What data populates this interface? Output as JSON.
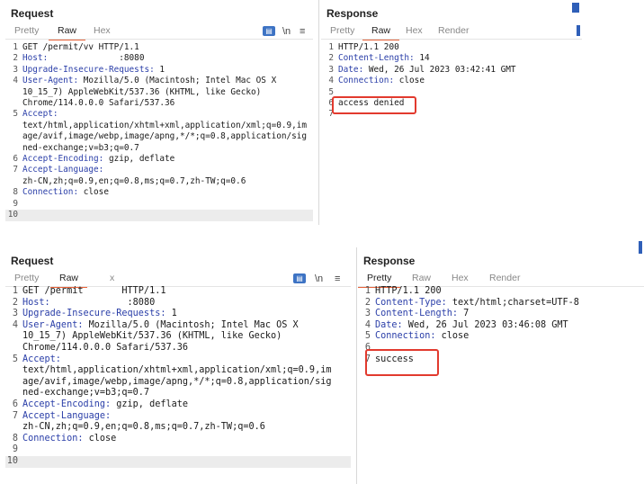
{
  "top": {
    "request": {
      "title": "Request",
      "tabs": [
        "Pretty",
        "Raw",
        "Hex"
      ],
      "active_tab": "Raw",
      "tools": {
        "toggle_icon": "\\n",
        "menu_icon": "≡"
      },
      "lines": [
        {
          "n": "1",
          "text": "GET /permit/vv HTTP/1.1"
        },
        {
          "n": "2",
          "key": "Host:",
          "text": "              :8080"
        },
        {
          "n": "3",
          "key": "Upgrade-Insecure-Requests:",
          "text": " 1"
        },
        {
          "n": "4",
          "key": "User-Agent:",
          "text": " Mozilla/5.0 (Macintosh; Intel Mac OS X"
        },
        {
          "n": "",
          "text": "10_15_7) AppleWebKit/537.36 (KHTML, like Gecko)"
        },
        {
          "n": "",
          "text": "Chrome/114.0.0.0 Safari/537.36"
        },
        {
          "n": "5",
          "key": "Accept:",
          "text": ""
        },
        {
          "n": "",
          "text": "text/html,application/xhtml+xml,application/xml;q=0.9,im"
        },
        {
          "n": "",
          "text": "age/avif,image/webp,image/apng,*/*;q=0.8,application/sig"
        },
        {
          "n": "",
          "text": "ned-exchange;v=b3;q=0.7"
        },
        {
          "n": "6",
          "key": "Accept-Encoding:",
          "text": " gzip, deflate"
        },
        {
          "n": "7",
          "key": "Accept-Language:",
          "text": ""
        },
        {
          "n": "",
          "text": "zh-CN,zh;q=0.9,en;q=0.8,ms;q=0.7,zh-TW;q=0.6"
        },
        {
          "n": "8",
          "key": "Connection:",
          "text": " close"
        },
        {
          "n": "9",
          "text": ""
        },
        {
          "n": "10",
          "text": "",
          "sel": true
        }
      ]
    },
    "response": {
      "title": "Response",
      "tabs": [
        "Pretty",
        "Raw",
        "Hex",
        "Render"
      ],
      "active_tab": "Raw",
      "lines": [
        {
          "n": "1",
          "text": "HTTP/1.1 200"
        },
        {
          "n": "2",
          "key": "Content-Length:",
          "text": " 14"
        },
        {
          "n": "3",
          "key": "Date:",
          "text": " Wed, 26 Jul 2023 03:42:41 GMT"
        },
        {
          "n": "4",
          "key": "Connection:",
          "text": " close"
        },
        {
          "n": "5",
          "text": ""
        },
        {
          "n": "6",
          "text": "access denied"
        },
        {
          "n": "7",
          "text": ""
        }
      ]
    }
  },
  "bottom": {
    "request": {
      "title": "Request",
      "tabs": [
        "Pretty",
        "Raw",
        "x"
      ],
      "active_tab": "Raw",
      "tools": {
        "toggle_icon": "\\n",
        "menu_icon": "≡"
      },
      "lines": [
        {
          "n": "1",
          "text": "GET /permit       HTTP/1.1"
        },
        {
          "n": "2",
          "key": "Host:",
          "text": "              :8080"
        },
        {
          "n": "3",
          "key": "Upgrade-Insecure-Requests:",
          "text": " 1"
        },
        {
          "n": "4",
          "key": "User-Agent:",
          "text": " Mozilla/5.0 (Macintosh; Intel Mac OS X"
        },
        {
          "n": "",
          "text": "10_15_7) AppleWebKit/537.36 (KHTML, like Gecko)"
        },
        {
          "n": "",
          "text": "Chrome/114.0.0.0 Safari/537.36"
        },
        {
          "n": "5",
          "key": "Accept:",
          "text": ""
        },
        {
          "n": "",
          "text": "text/html,application/xhtml+xml,application/xml;q=0.9,im"
        },
        {
          "n": "",
          "text": "age/avif,image/webp,image/apng,*/*;q=0.8,application/sig"
        },
        {
          "n": "",
          "text": "ned-exchange;v=b3;q=0.7"
        },
        {
          "n": "6",
          "key": "Accept-Encoding:",
          "text": " gzip, deflate"
        },
        {
          "n": "7",
          "key": "Accept-Language:",
          "text": ""
        },
        {
          "n": "",
          "text": "zh-CN,zh;q=0.9,en;q=0.8,ms;q=0.7,zh-TW;q=0.6"
        },
        {
          "n": "8",
          "key": "Connection:",
          "text": " close"
        },
        {
          "n": "9",
          "text": ""
        },
        {
          "n": "10",
          "text": "",
          "sel": true
        }
      ]
    },
    "response": {
      "title": "Response",
      "tabs": [
        "Pretty",
        "Raw",
        "Hex",
        "Render"
      ],
      "active_tab": "Pretty",
      "lines": [
        {
          "n": "1",
          "text": "HTTP/1.1 200"
        },
        {
          "n": "2",
          "key": "Content-Type:",
          "text": " text/html;charset=UTF-8"
        },
        {
          "n": "3",
          "key": "Content-Length:",
          "text": " 7"
        },
        {
          "n": "4",
          "key": "Date:",
          "text": " Wed, 26 Jul 2023 03:46:08 GMT"
        },
        {
          "n": "5",
          "key": "Connection:",
          "text": " close"
        },
        {
          "n": "6",
          "text": ""
        },
        {
          "n": "7",
          "text": "success"
        }
      ]
    }
  },
  "colors": {
    "accent": "#e8633a",
    "highlight_box": "#e23a2e",
    "header_key": "#2a3ea8",
    "toolbar_icon": "#3d73c4"
  }
}
